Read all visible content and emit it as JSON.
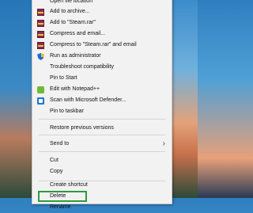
{
  "menu": {
    "items": [
      {
        "label": "Open file location",
        "icon": ""
      },
      {
        "label": "Add to archive...",
        "icon": "winrar-icon"
      },
      {
        "label": "Add to \"Steam.rar\"",
        "icon": "winrar-icon"
      },
      {
        "label": "Compress and email...",
        "icon": "winrar-icon"
      },
      {
        "label": "Compress to \"Steam.rar\" and email",
        "icon": "winrar-icon"
      },
      {
        "label": "Run as administrator",
        "icon": "uac-shield-icon"
      },
      {
        "label": "Troubleshoot compatibility",
        "icon": ""
      },
      {
        "label": "Pin to Start",
        "icon": ""
      },
      {
        "label": "Edit with Notepad++",
        "icon": "notepad-plus-plus-icon"
      },
      {
        "label": "Scan with Microsoft Defender...",
        "icon": "defender-icon"
      },
      {
        "label": "Pin to taskbar",
        "icon": ""
      },
      {
        "label": "Restore previous versions",
        "icon": ""
      },
      {
        "label": "Send to",
        "icon": "chevron-right-icon"
      },
      {
        "label": "Cut",
        "icon": ""
      },
      {
        "label": "Copy",
        "icon": ""
      },
      {
        "label": "Create shortcut",
        "icon": ""
      },
      {
        "label": "Delete",
        "icon": ""
      },
      {
        "label": "Rename",
        "icon": ""
      }
    ],
    "submenu_arrow": "›"
  },
  "colors": {
    "menu_bg": "#f2f2f2",
    "separator": "#d4d4d4",
    "highlight_border": "#2e9a3c"
  }
}
